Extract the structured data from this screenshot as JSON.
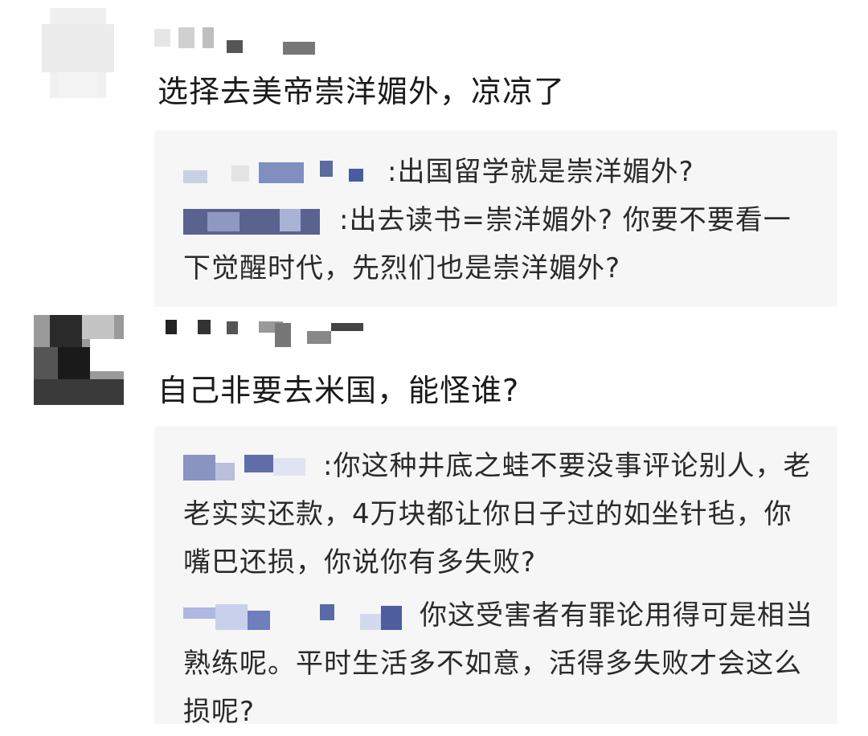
{
  "comments": [
    {
      "text": "选择去美帝崇洋媚外，凉凉了",
      "replies": [
        {
          "sep": ":",
          "text": "出国留学就是崇洋媚外?"
        },
        {
          "sep": ":",
          "text": "出去读书=崇洋媚外?  你要不要看一下觉醒时代，先烈们也是崇洋媚外?"
        }
      ]
    },
    {
      "text": "自己非要去米国，能怪谁?",
      "replies": [
        {
          "sep": ":",
          "text": "你这种井底之蛙不要没事评论别人，老老实实还款，4万块都让你日子过的如坐针毡，你嘴巴还损，你说你有多失败?"
        },
        {
          "sep": "",
          "text": "你这受害者有罪论用得可是相当熟练呢。平时生活多不如意，活得多失败才会这么损呢?"
        }
      ]
    }
  ],
  "colors": {
    "reply_bg": "#f6f6f6",
    "text": "#1f1f1f",
    "blur_blue": "#6b7fc0",
    "blur_gray": "#8a8a8a"
  }
}
